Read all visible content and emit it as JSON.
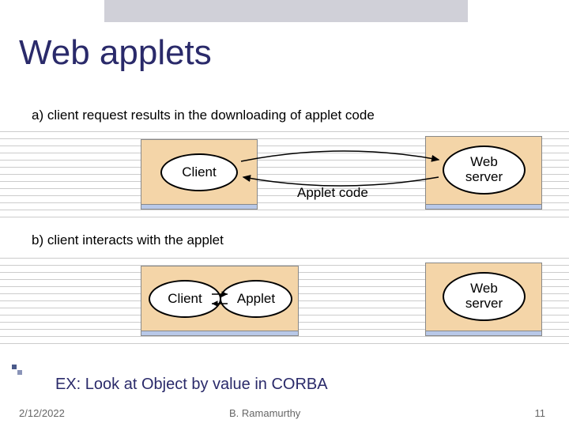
{
  "title": "Web applets",
  "caption_a": "a) client request results in the downloading of applet code",
  "caption_b": "b) client  interacts with the applet",
  "client_label": "Client",
  "applet_code_label": "Applet code",
  "web_server_label_1": "Web",
  "web_server_label_2": "server",
  "applet_label": "Applet",
  "ex_line": "EX: Look at Object by value in CORBA",
  "footer": {
    "date": "2/12/2022",
    "author": "B. Ramamurthy",
    "page": "11"
  }
}
